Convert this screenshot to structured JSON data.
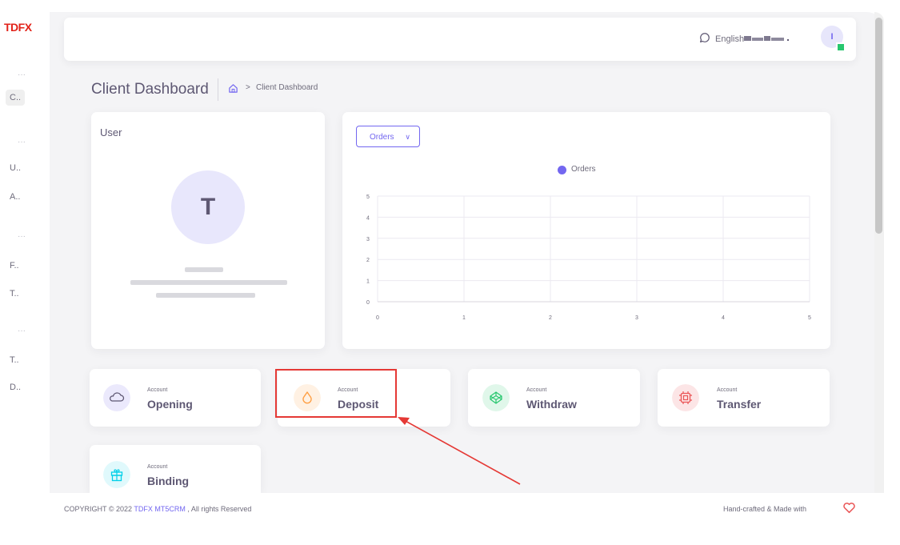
{
  "brand": {
    "logo_text": "TDFX",
    "logo_color": "#e2231a"
  },
  "sidebar": {
    "items": [
      {
        "type": "dots",
        "label": "···"
      },
      {
        "type": "item",
        "label": "C..",
        "active": true
      },
      {
        "type": "dots",
        "label": "···"
      },
      {
        "type": "item",
        "label": "U.."
      },
      {
        "type": "item",
        "label": "A.."
      },
      {
        "type": "dots",
        "label": "···"
      },
      {
        "type": "item",
        "label": "F.."
      },
      {
        "type": "item",
        "label": "T.."
      },
      {
        "type": "dots",
        "label": "···"
      },
      {
        "type": "item",
        "label": "T.."
      },
      {
        "type": "item",
        "label": "D.."
      }
    ]
  },
  "topbar": {
    "language": "English",
    "avatar_initial": "I",
    "icons": {
      "language": "chat-bubble-icon",
      "status": "online-status-icon"
    }
  },
  "page": {
    "title": "Client Dashboard",
    "breadcrumb": {
      "separator": ">",
      "current": "Client Dashboard",
      "home_icon": "home-icon"
    }
  },
  "user_card": {
    "title": "User",
    "avatar_initial": "T"
  },
  "chart_card": {
    "dropdown_label": "Orders",
    "chart_data": {
      "type": "line",
      "title": "",
      "legend": [
        {
          "name": "Orders",
          "color": "#7367f0"
        }
      ],
      "legend_position": "top-center",
      "series": [
        {
          "name": "Orders",
          "values": []
        }
      ],
      "x_ticks": [
        "0",
        "1",
        "2",
        "3",
        "4",
        "5"
      ],
      "y_ticks": [
        "0",
        "1",
        "2",
        "3",
        "4",
        "5"
      ],
      "xlim": [
        0,
        5
      ],
      "ylim": [
        0,
        5
      ],
      "grid": true
    }
  },
  "actions": [
    {
      "small": "Account",
      "big": "Opening",
      "icon": "cloud-icon",
      "bg": "#ebe9fc",
      "fg": "#7367f0"
    },
    {
      "small": "Account",
      "big": "Deposit",
      "icon": "droplet-icon",
      "bg": "#fff1e3",
      "fg": "#ff9f43"
    },
    {
      "small": "Account",
      "big": "Withdraw",
      "icon": "codepen-icon",
      "bg": "#e0f7ea",
      "fg": "#28c76f"
    },
    {
      "small": "Account",
      "big": "Transfer",
      "icon": "cpu-icon",
      "bg": "#fce5e6",
      "fg": "#ea5455"
    },
    {
      "small": "Account",
      "big": "Binding",
      "icon": "gift-icon",
      "bg": "#e0f9fc",
      "fg": "#00cfe8"
    }
  ],
  "annotation": {
    "highlight_color": "#e53935",
    "target": "Deposit"
  },
  "footer": {
    "copyright_prefix": "COPYRIGHT © 2022",
    "brand_link": "TDFX MT5CRM",
    "copyright_suffix": ", All rights Reserved",
    "right_text": "Hand-crafted & Made with",
    "heart_color": "#ea5455"
  },
  "colors": {
    "primary": "#7367f0",
    "background": "#f4f4f6",
    "card": "#ffffff",
    "text": "#5e5873"
  }
}
